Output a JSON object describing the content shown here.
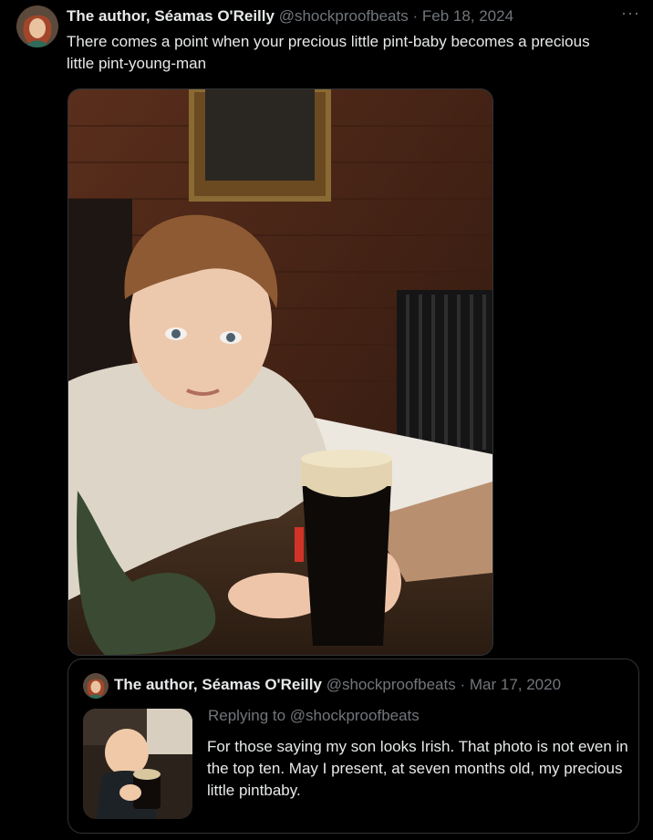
{
  "tweet": {
    "author_name": "The author, Séamas O'Reilly",
    "handle": "@shockproofbeats",
    "separator": "·",
    "date": "Feb 18, 2024",
    "text": "There comes a point when your precious little pint-baby becomes a precious little pint-young-man",
    "more_icon": "more-horizontal-icon",
    "photo_alt": "photo"
  },
  "quoted": {
    "author_name": "The author, Séamas O'Reilly",
    "handle": "@shockproofbeats",
    "separator": "·",
    "date": "Mar 17, 2020",
    "replying_to": "Replying to @shockproofbeats",
    "text": "For those saying my son looks Irish. That photo is not even in the top ten. May I present, at seven months old, my precious little pintbaby."
  },
  "colors": {
    "background": "#000000",
    "text": "#e7e9ea",
    "muted": "#71767b",
    "border": "#2f3336"
  }
}
